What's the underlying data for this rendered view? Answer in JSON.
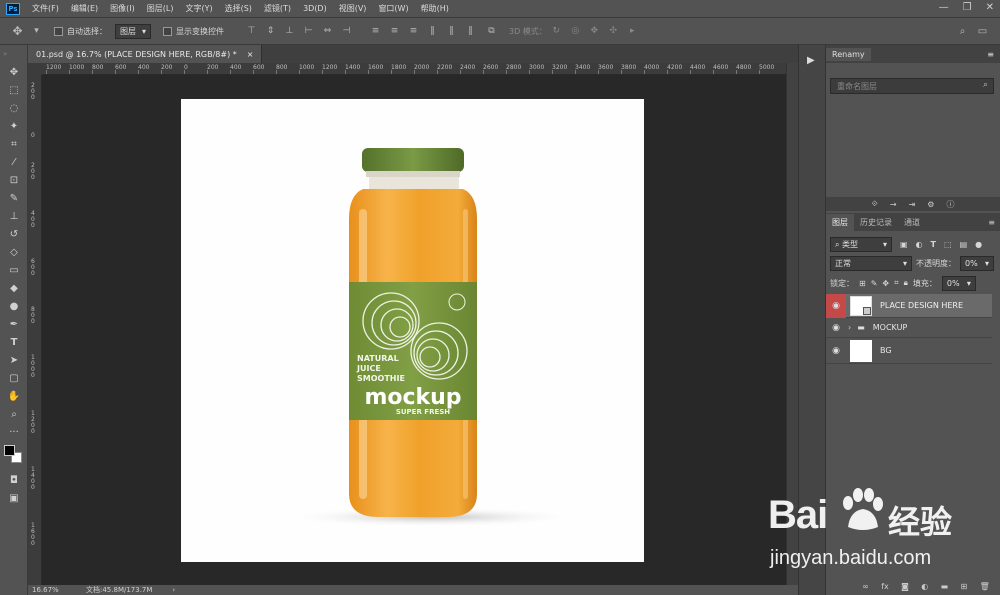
{
  "menu": {
    "logo": "Ps",
    "items": [
      "文件(F)",
      "编辑(E)",
      "图像(I)",
      "图层(L)",
      "文字(Y)",
      "选择(S)",
      "滤镜(T)",
      "3D(D)",
      "视图(V)",
      "窗口(W)",
      "帮助(H)"
    ]
  },
  "options": {
    "auto_select_label": "自动选择：",
    "auto_select_value": "图层",
    "show_transform_label": "显示变换控件",
    "mode_3d_label": "3D 模式："
  },
  "document": {
    "tab_title": "01.psd @ 16.7% (PLACE DESIGN HERE, RGB/8#) *",
    "zoom": "16.67%",
    "doc_size": "文档:45.8M/173.7M"
  },
  "ruler_h": [
    "1200",
    "1000",
    "800",
    "600",
    "400",
    "200",
    "0",
    "200",
    "400",
    "600",
    "800",
    "1000",
    "1200",
    "1400",
    "1600",
    "1800",
    "2000",
    "2200",
    "2400",
    "2600",
    "2800",
    "3000",
    "3200",
    "3400",
    "3600",
    "3800",
    "4000",
    "4200",
    "4400",
    "4600",
    "4800",
    "5000"
  ],
  "bottle": {
    "label_line1": "NATURAL",
    "label_line2": "JUICE",
    "label_line3": "SMOOTHIE",
    "brand": "mockup",
    "tagline": "SUPER FRESH"
  },
  "renamy": {
    "title": "Renamy",
    "search_placeholder": "重命名图层"
  },
  "layers_panel": {
    "tabs": [
      "图层",
      "历史记录",
      "通道"
    ],
    "filter_label": "类型",
    "blend_mode": "正常",
    "opacity_label": "不透明度：",
    "opacity_value": "0%",
    "lock_label": "锁定：",
    "fill_label": "填充：",
    "fill_value": "0%",
    "layers": [
      {
        "name": "PLACE DESIGN HERE"
      },
      {
        "name": "MOCKUP"
      },
      {
        "name": "BG"
      }
    ]
  },
  "watermark": {
    "brand": "Bai",
    "brand2": "经验",
    "url": "jingyan.baidu.com"
  },
  "colors": {
    "bottle_cap": "#6b8a3a",
    "juice": "#f0a12a",
    "label": "#7d9a3f",
    "selected_layer_eye": "#c44a4a"
  }
}
